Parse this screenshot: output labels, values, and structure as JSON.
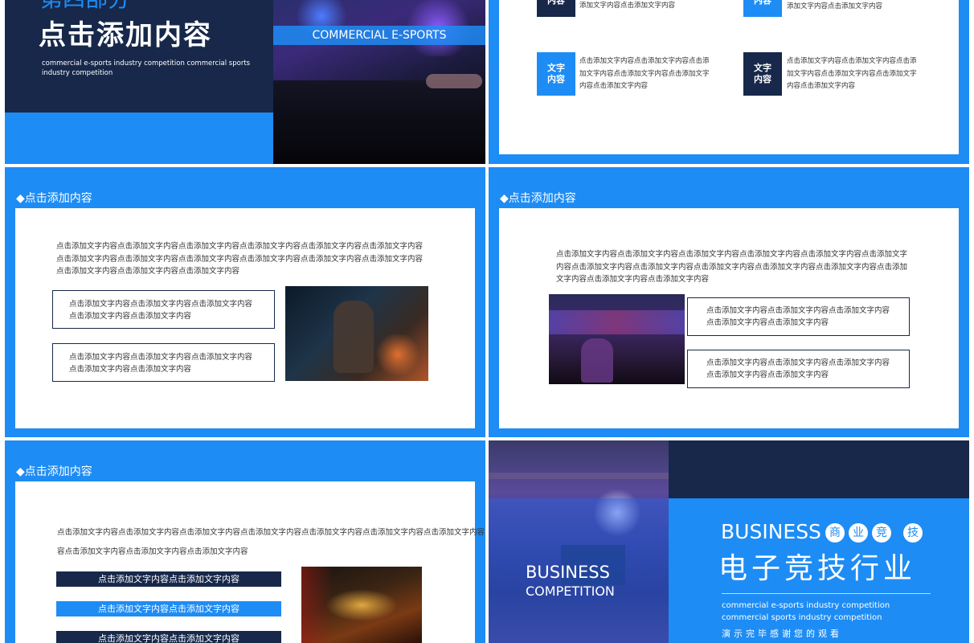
{
  "slide1": {
    "part_label": "第四部分",
    "title": "点击添加内容",
    "subtitle": "commercial e-sports industry competition commercial  sports industry competition",
    "banner": "COMMERCIAL E-SPORTS"
  },
  "slide2": {
    "items": [
      {
        "tag": "文字\n内容",
        "text": "添加文字内容点击添加文字内容"
      },
      {
        "tag": "文字\n内容",
        "text": "添加文字内容点击添加文字内容"
      },
      {
        "tag": "文字\n内容",
        "text": "点击添加文字内容点击添加文字内容点击添加文字内容点击添加文字内容点击添加文字内容点击添加文字内容"
      },
      {
        "tag": "文字\n内容",
        "text": "点击添加文字内容点击添加文字内容点击添加文字内容点击添加文字内容点击添加文字内容点击添加文字内容"
      }
    ]
  },
  "slide3": {
    "title": "◆点击添加内容",
    "paragraph": "点击添加文字内容点击添加文字内容点击添加文字内容点击添加文字内容点击添加文字内容点击添加文字内容点击添加文字内容点击添加文字内容点击添加文字内容点击添加文字内容点击添加文字内容点击添加文字内容点击添加文字内容点击添加文字内容点击添加文字内容",
    "box1": "点击添加文字内容点击添加文字内容点击添加文字内容点击添加文字内容点击添加文字内容",
    "box2": "点击添加文字内容点击添加文字内容点击添加文字内容点击添加文字内容点击添加文字内容"
  },
  "slide4": {
    "title": "◆点击添加内容",
    "paragraph": "点击添加文字内容点击添加文字内容点击添加文字内容点击添加文字内容点击添加文字内容点击添加文字内容点击添加文字内容点击添加文字内容点击添加文字内容点击添加文字内容点击添加文字内容点击添加文字内容点击添加文字内容点击添加文字内容",
    "box1": "点击添加文字内容点击添加文字内容点击添加文字内容点击添加文字内容点击添加文字内容",
    "box2": "点击添加文字内容点击添加文字内容点击添加文字内容点击添加文字内容点击添加文字内容"
  },
  "slide5": {
    "title": "◆点击添加内容",
    "paragraph1": "点击添加文字内容点击添加文字内容点击添加文字内容点击添加文字内容点击添加文字内容点击添加文字内容点击添加文字内容点击添加文字内",
    "paragraph2": "容点击添加文字内容点击添加文字内容点击添加文字内容",
    "bars": [
      "点击添加文字内容点击添加文字内容",
      "点击添加文字内容点击添加文字内容",
      "点击添加文字内容点击添加文字内容"
    ]
  },
  "slide6": {
    "photo_line1": "BUSINESS",
    "photo_line2": "COMPETITION",
    "heading": "BUSINESS",
    "chars": [
      "商",
      "业",
      "竞",
      "技"
    ],
    "title": "电子竞技行业",
    "subtitle": "commercial e-sports industry competition commercial sports industry competition",
    "thanks": "演示完毕感谢您的观看"
  },
  "colors": {
    "blue": "#1e8cf5",
    "navy": "#17284a",
    "white": "#ffffff"
  }
}
